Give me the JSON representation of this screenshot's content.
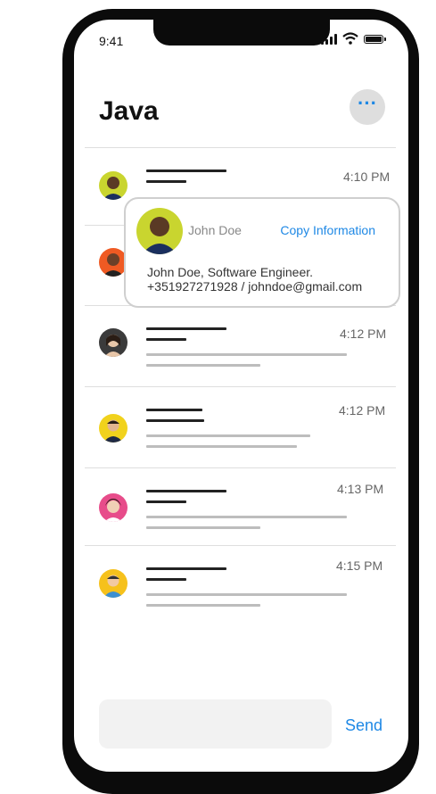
{
  "status_bar": {
    "time": "9:41"
  },
  "header": {
    "title": "Java",
    "more_icon": "ellipsis-icon"
  },
  "messages": [
    {
      "time": "4:10 PM"
    },
    {
      "time": ""
    },
    {
      "time": "4:12 PM"
    },
    {
      "time": "4:12 PM"
    },
    {
      "time": "4:13 PM"
    },
    {
      "time": "4:15 PM"
    }
  ],
  "popup": {
    "name": "John Doe",
    "copy_label": "Copy Information",
    "details_line1": "John Doe, Software Engineer.",
    "details_line2": "+351927271928 /  johndoe@gmail.com"
  },
  "composer": {
    "send_label": "Send"
  },
  "colors": {
    "accent": "#1e88e5",
    "divider": "#dedede",
    "compose_bg": "#f2f2f2"
  }
}
